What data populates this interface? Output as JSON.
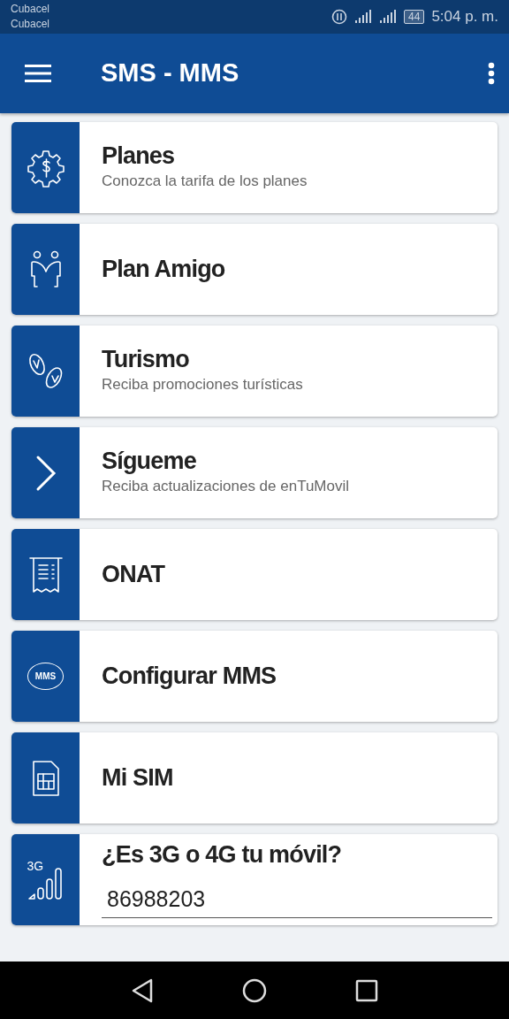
{
  "status_bar": {
    "carriers": [
      "Cubacel",
      "Cubacel"
    ],
    "battery": "44",
    "time": "5:04 p. m."
  },
  "app_bar": {
    "title": "SMS - MMS"
  },
  "items": [
    {
      "kind": "menu",
      "title": "Planes",
      "subtitle": "Conozca la tarifa de los planes"
    },
    {
      "kind": "menu",
      "title": "Plan Amigo"
    },
    {
      "kind": "menu",
      "title": "Turismo",
      "subtitle": "Reciba promociones turísticas"
    },
    {
      "kind": "menu",
      "title": "Sígueme",
      "subtitle": "Reciba actualizaciones de enTuMovil"
    },
    {
      "kind": "menu",
      "title": "ONAT"
    },
    {
      "kind": "menu",
      "title": "Configurar MMS",
      "icon_text": "MMS"
    },
    {
      "kind": "menu",
      "title": "Mi SIM"
    },
    {
      "kind": "input",
      "title": "¿Es 3G o 4G tu móvil?",
      "value": "86988203",
      "icon_text": "3G"
    }
  ]
}
